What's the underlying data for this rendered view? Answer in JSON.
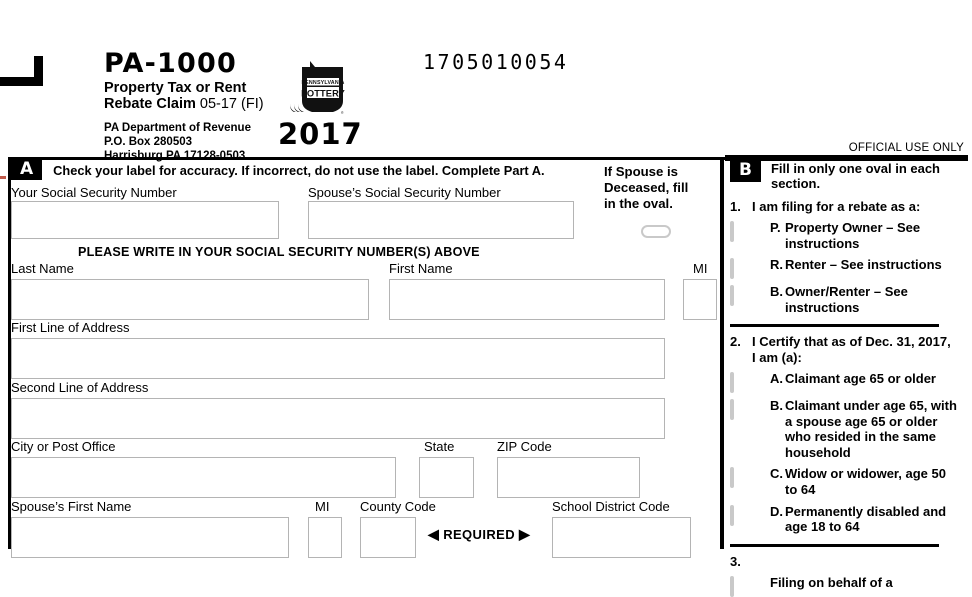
{
  "header": {
    "form_number": "PA-1000",
    "form_title_line1": "Property Tax or Rent",
    "form_title_line2": "Rebate Claim",
    "form_revision": "05-17 (FI)",
    "dept_line1": "PA Department of Revenue",
    "dept_line2": "P.O. Box 280503",
    "dept_line3": "Harrisburg PA 17128-0503",
    "tax_year": "2017",
    "control_number": "1705010054",
    "official_use": "OFFICIAL USE ONLY",
    "lottery_logo_line1": "PENNSYLVANIA",
    "lottery_logo_line2": "LOTTERY"
  },
  "part_a": {
    "badge": "A",
    "instruction": "Check your label for accuracy. If incorrect, do not use the label. Complete Part A.",
    "ssn_note": "PLEASE WRITE IN YOUR SOCIAL SECURITY NUMBER(S) ABOVE",
    "required_tag": "REQUIRED",
    "arrow_left": "◀",
    "arrow_right": "▶",
    "spouse_deceased": {
      "line1": "If Spouse is",
      "line2": "Deceased, fill",
      "line3": "in the oval."
    },
    "fields": {
      "your_ssn": {
        "label": "Your Social Security Number",
        "value": ""
      },
      "spouse_ssn": {
        "label": "Spouse’s Social Security Number",
        "value": ""
      },
      "last_name": {
        "label": "Last Name",
        "value": ""
      },
      "first_name": {
        "label": "First Name",
        "value": ""
      },
      "mi": {
        "label": "MI",
        "value": ""
      },
      "address1": {
        "label": "First Line of Address",
        "value": ""
      },
      "address2": {
        "label": "Second Line of Address",
        "value": ""
      },
      "city": {
        "label": "City or Post Office",
        "value": ""
      },
      "state": {
        "label": "State",
        "value": ""
      },
      "zip": {
        "label": "ZIP Code",
        "value": ""
      },
      "spouse_first_name": {
        "label": "Spouse’s First Name",
        "value": ""
      },
      "spouse_mi": {
        "label": "MI",
        "value": ""
      },
      "county_code": {
        "label": "County Code",
        "value": ""
      },
      "school_district_code": {
        "label": "School District Code",
        "value": ""
      }
    }
  },
  "part_b": {
    "badge": "B",
    "instruction": "Fill in only one oval in each section.",
    "questions": [
      {
        "number": "1.",
        "text": "I am filing for a rebate as a:",
        "options": [
          {
            "letter": "P.",
            "text": "Property Owner – See instructions",
            "selected": false
          },
          {
            "letter": "R.",
            "text": "Renter – See instructions",
            "selected": false
          },
          {
            "letter": "B.",
            "text": "Owner/Renter – See instructions",
            "selected": false
          }
        ]
      },
      {
        "number": "2.",
        "text": "I Certify that as of Dec. 31, 2017, I am (a):",
        "options": [
          {
            "letter": "A.",
            "text": "Claimant age 65 or older",
            "selected": false
          },
          {
            "letter": "B.",
            "text": "Claimant under age 65, with a spouse age 65 or older who resided in the same household",
            "selected": false
          },
          {
            "letter": "C.",
            "text": "Widow or widower, age 50 to 64",
            "selected": false
          },
          {
            "letter": "D.",
            "text": "Permanently disabled and age 18 to 64",
            "selected": false
          }
        ]
      },
      {
        "number": "3.",
        "text": "",
        "options": [
          {
            "letter": "",
            "text": "Filing on behalf of a",
            "selected": false
          }
        ]
      }
    ]
  }
}
